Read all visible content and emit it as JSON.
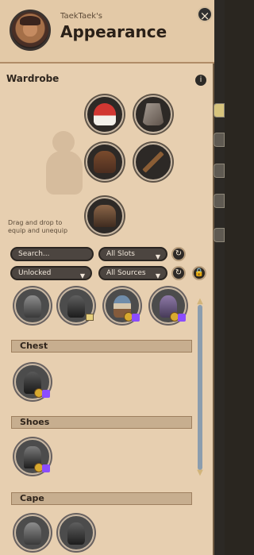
{
  "window": {
    "owner": "TaekTaek's",
    "title": "Appearance",
    "close": "×"
  },
  "wardrobe": {
    "title": "Wardrobe",
    "info": "i",
    "drag_help": "Drag and drop to equip and unequip"
  },
  "filters": {
    "search_placeholder": "Search...",
    "slots": "All Slots",
    "unlocked": "Unlocked",
    "sources": "All Sources"
  },
  "icons": {
    "close": "close-icon",
    "info": "info-icon",
    "refresh": "refresh-icon",
    "lock": "lock-icon",
    "dropdown": "chevron-down-icon",
    "scroll_up": "scroll-up-icon",
    "scroll_down": "scroll-down-icon"
  },
  "sections": {
    "chest": "Chest",
    "shoes": "Shoes",
    "cape": "Cape"
  },
  "symbols": {
    "dropdown": "▼",
    "refresh": "↻",
    "lock": "🔒",
    "scroll_up": "▲",
    "scroll_down": "▼"
  }
}
